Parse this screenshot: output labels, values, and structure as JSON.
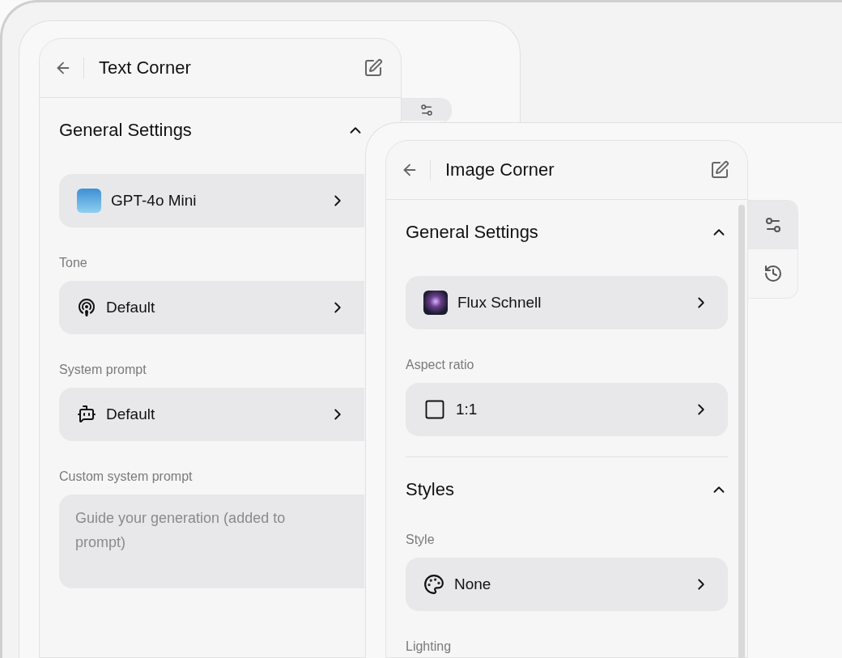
{
  "windows": [
    {
      "title": "Text Corner",
      "side_tabs": [
        {
          "kind": "settings",
          "selected": true
        }
      ],
      "sections": [
        {
          "title": "General Settings",
          "expanded": true,
          "fields": [
            {
              "kind": "model",
              "value": "GPT-4o Mini"
            },
            {
              "kind": "tone",
              "label": "Tone",
              "value": "Default"
            },
            {
              "kind": "system",
              "label": "System prompt",
              "value": "Default"
            },
            {
              "kind": "text",
              "label": "Custom system prompt",
              "placeholder": "Guide your generation (added to prompt)"
            }
          ]
        }
      ]
    },
    {
      "title": "Image Corner",
      "side_tabs": [
        {
          "kind": "settings",
          "selected": true
        },
        {
          "kind": "history",
          "selected": false
        }
      ],
      "sections": [
        {
          "title": "General Settings",
          "expanded": true,
          "fields": [
            {
              "kind": "photo-model",
              "value": "Flux Schnell"
            },
            {
              "kind": "aspect",
              "label": "Aspect ratio",
              "value": "1:1"
            }
          ]
        },
        {
          "title": "Styles",
          "expanded": true,
          "fields": [
            {
              "kind": "style",
              "label": "Style",
              "value": "None"
            },
            {
              "kind": "label",
              "label": "Lighting"
            }
          ]
        }
      ]
    }
  ]
}
